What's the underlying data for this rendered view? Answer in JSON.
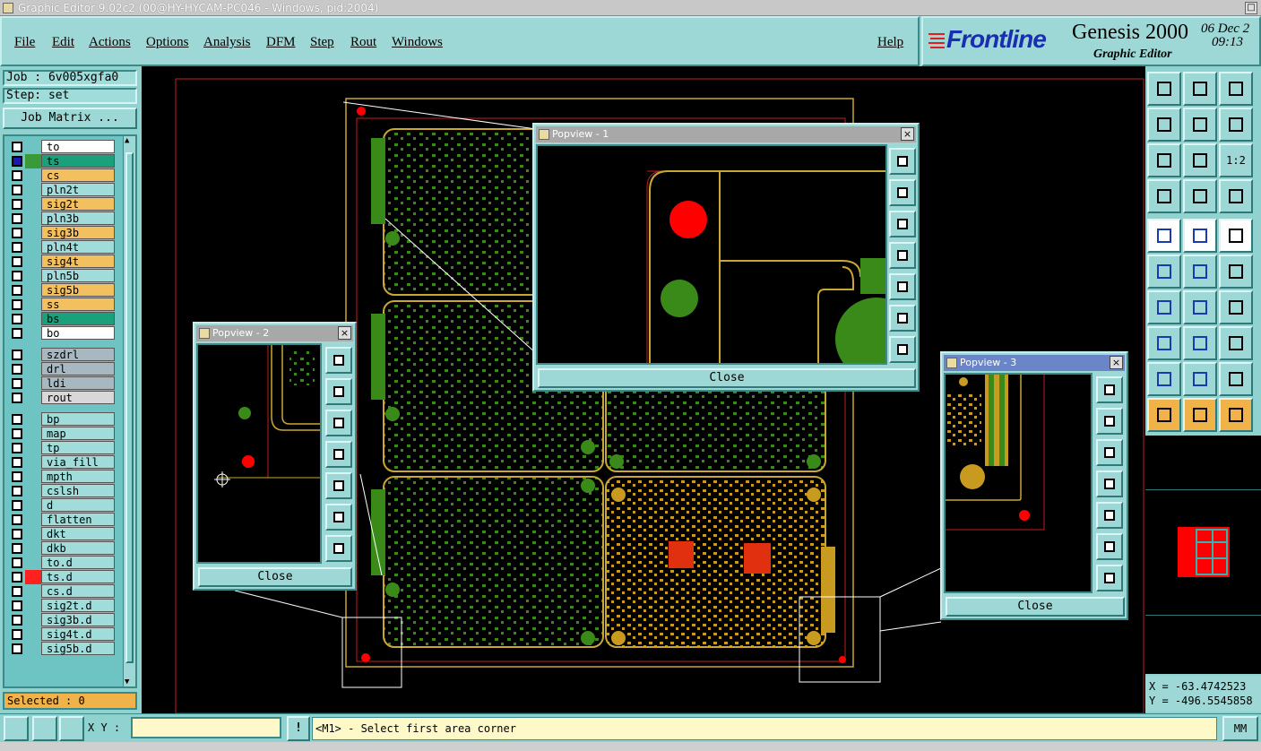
{
  "window": {
    "title": "Graphic Editor 9.02c2 (00@HY-HYCAM-PC046 - Windows, pid:2004)"
  },
  "menu": {
    "items": [
      "File",
      "Edit",
      "Actions",
      "Options",
      "Analysis",
      "DFM",
      "Step",
      "Rout",
      "Windows"
    ],
    "help": "Help"
  },
  "brand": {
    "logo": "Frontline",
    "product": "Genesis 2000",
    "subtitle": "Graphic Editor",
    "date": "06 Dec 2",
    "time": "09:13"
  },
  "job": {
    "job_label": "Job : 6v005xgfa0",
    "step_label": "Step: set",
    "matrix_button": "Job Matrix ..."
  },
  "layers": [
    {
      "name": "to",
      "color": "#ffffff"
    },
    {
      "name": "ts",
      "color": "#1aa07a",
      "swatch": "#3a9a3a"
    },
    {
      "name": "cs",
      "color": "#f3c060"
    },
    {
      "name": "pln2t",
      "color": "#9fdcda"
    },
    {
      "name": "sig2t",
      "color": "#f3c060"
    },
    {
      "name": "pln3b",
      "color": "#9fdcda"
    },
    {
      "name": "sig3b",
      "color": "#f3c060"
    },
    {
      "name": "pln4t",
      "color": "#9fdcda"
    },
    {
      "name": "sig4t",
      "color": "#f3c060"
    },
    {
      "name": "pln5b",
      "color": "#9fdcda"
    },
    {
      "name": "sig5b",
      "color": "#f3c060"
    },
    {
      "name": "ss",
      "color": "#f3c060"
    },
    {
      "name": "bs",
      "color": "#1aa07a"
    },
    {
      "name": "bo",
      "color": "#ffffff"
    },
    {
      "name": "szdrl",
      "color": "#a8b8c0"
    },
    {
      "name": "drl",
      "color": "#a8b8c0"
    },
    {
      "name": "ldi",
      "color": "#a8b8c0"
    },
    {
      "name": "rout",
      "color": "#d8d8d8"
    },
    {
      "name": "bp",
      "color": "#9fdcda"
    },
    {
      "name": "map",
      "color": "#9fdcda"
    },
    {
      "name": "tp",
      "color": "#9fdcda"
    },
    {
      "name": "via_fill",
      "color": "#9fdcda"
    },
    {
      "name": "mpth",
      "color": "#9fdcda"
    },
    {
      "name": "cslsh",
      "color": "#9fdcda"
    },
    {
      "name": "d",
      "color": "#9fdcda"
    },
    {
      "name": "flatten",
      "color": "#9fdcda"
    },
    {
      "name": "dkt",
      "color": "#9fdcda"
    },
    {
      "name": "dkb",
      "color": "#9fdcda"
    },
    {
      "name": "to.d",
      "color": "#9fdcda"
    },
    {
      "name": "ts.d",
      "color": "#9fdcda",
      "swatch": "#ff2020"
    },
    {
      "name": "cs.d",
      "color": "#9fdcda"
    },
    {
      "name": "sig2t.d",
      "color": "#9fdcda"
    },
    {
      "name": "sig3b.d",
      "color": "#9fdcda"
    },
    {
      "name": "sig4t.d",
      "color": "#9fdcda"
    },
    {
      "name": "sig5b.d",
      "color": "#9fdcda"
    }
  ],
  "selected": "Selected : 0",
  "popviews": [
    {
      "title": "Popview - 1",
      "close": "Close"
    },
    {
      "title": "Popview - 2",
      "close": "Close"
    },
    {
      "title": "Popview - 3",
      "close": "Close"
    }
  ],
  "coords": {
    "x": "X = -63.4742523",
    "y": "Y = -496.5545858"
  },
  "status": {
    "xy_label": "X Y :",
    "xy_value": "",
    "message": "<M1> - Select first area corner",
    "units": "MM"
  },
  "toolbar": {
    "scale_label": "1:2"
  },
  "colors": {
    "panel": "#9dd8d6",
    "board_green": "#3a8a1a",
    "pad_red": "#ff0000",
    "outline_gold": "#c9a832"
  }
}
